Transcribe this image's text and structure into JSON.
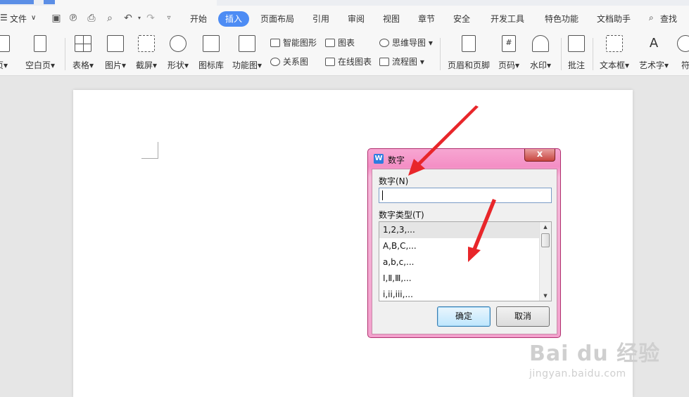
{
  "menu": {
    "file_label": "文件",
    "tabs": [
      "开始",
      "插入",
      "页面布局",
      "引用",
      "审阅",
      "视图",
      "章节",
      "安全",
      "开发工具",
      "特色功能",
      "文档助手"
    ],
    "active_tab": "插入",
    "search_label": "查找"
  },
  "ribbon": {
    "page_label": "页",
    "blank_page_label": "空白页",
    "table_label": "表格",
    "picture_label": "图片",
    "screenshot_label": "截屏",
    "shape_label": "形状",
    "icon_lib_label": "图标库",
    "func_chart_label": "功能图",
    "smart_art_label": "智能图形",
    "relation_label": "关系图",
    "chart_label": "图表",
    "online_chart_label": "在线图表",
    "mindmap_label": "思维导图",
    "flowchart_label": "流程图",
    "header_footer_label": "页眉和页脚",
    "page_number_label": "页码",
    "watermark_label": "水印",
    "comment_label": "批注",
    "textbox_label": "文本框",
    "wordart_label": "艺术字",
    "symbol_label": "符"
  },
  "dialog": {
    "title": "数字",
    "number_label": "数字(N)",
    "number_value": "",
    "type_label": "数字类型(T)",
    "types": [
      "1,2,3,...",
      "A,B,C,...",
      "a,b,c,...",
      "Ⅰ,Ⅱ,Ⅲ,...",
      "i,ii,iii,..."
    ],
    "selected_type": "1,2,3,...",
    "ok_label": "确定",
    "cancel_label": "取消",
    "close_glyph": "x"
  },
  "watermark": {
    "brand": "Bai du 经验",
    "url": "jingyan.baidu.com"
  },
  "colors": {
    "accent": "#4d8cf4",
    "dialog_frame": "#f48fc5",
    "arrow": "#e8262a"
  }
}
